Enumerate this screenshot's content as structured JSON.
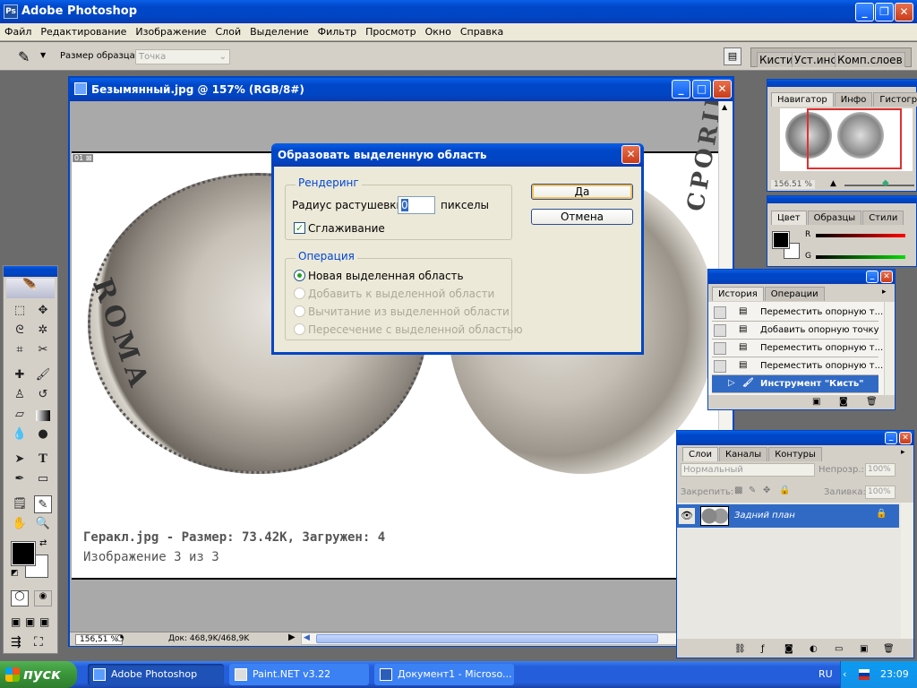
{
  "app": {
    "title": "Adobe Photoshop"
  },
  "menu": [
    "Файл",
    "Редактирование",
    "Изображение",
    "Слой",
    "Выделение",
    "Фильтр",
    "Просмотр",
    "Окно",
    "Справка"
  ],
  "options": {
    "sample_label": "Размер образца:",
    "sample_value": "Точка",
    "tabs": [
      "Кисти",
      "Уст.инст",
      "Комп.слоев"
    ]
  },
  "document": {
    "title": "Безымянный.jpg @ 157% (RGB/8#)",
    "caption_line1": "Геракл.jpg - Размер: 73.42K, Загружен: 4",
    "caption_line2": "Изображение 3 из 3",
    "zoom": "156,51 %",
    "doc_info": "Док: 468,9K/468,9K",
    "coin_left_text": "ROMA",
    "coin_right_text": "CPORIDIS"
  },
  "dialog": {
    "title": "Образовать выделенную область",
    "rendering_legend": "Рендеринг",
    "feather_label": "Радиус растушевки:",
    "feather_value": "0",
    "feather_unit": "пикселы",
    "antialias_label": "Сглаживание",
    "antialias_checked": true,
    "operation_legend": "Операция",
    "operations": [
      {
        "label": "Новая выделенная область",
        "enabled": true,
        "selected": true
      },
      {
        "label": "Добавить к выделенной области",
        "enabled": false,
        "selected": false
      },
      {
        "label": "Вычитание из выделенной области",
        "enabled": false,
        "selected": false
      },
      {
        "label": "Пересечение с выделенной областью",
        "enabled": false,
        "selected": false
      }
    ],
    "ok_label": "Да",
    "cancel_label": "Отмена"
  },
  "navigator": {
    "tabs": [
      "Навигатор",
      "Инфо",
      "Гистограмма"
    ],
    "zoom": "156.51 %"
  },
  "color": {
    "tabs": [
      "Цвет",
      "Образцы",
      "Стили"
    ],
    "channels": [
      "R",
      "G"
    ]
  },
  "history": {
    "tabs": [
      "История",
      "Операции"
    ],
    "items": [
      "Переместить опорную т...",
      "Добавить опорную точку",
      "Переместить опорную т...",
      "Переместить опорную т...",
      "Инструмент \"Кисть\""
    ]
  },
  "layers": {
    "tabs": [
      "Слои",
      "Каналы",
      "Контуры"
    ],
    "blend_mode": "Нормальный",
    "opacity_label": "Непрозр.:",
    "opacity_value": "100%",
    "lock_label": "Закрепить:",
    "fill_label": "Заливка:",
    "fill_value": "100%",
    "layer_name": "Задний план"
  },
  "taskbar": {
    "start": "пуск",
    "tasks": [
      "Adobe Photoshop",
      "Paint.NET v3.22",
      "Документ1 - Microso..."
    ],
    "lang": "RU",
    "time": "23:09"
  },
  "colors": {
    "xp_blue": "#0046c4",
    "taskbar": "#245edb",
    "start_green": "#3c9a3c",
    "selection": "#316ac5"
  }
}
